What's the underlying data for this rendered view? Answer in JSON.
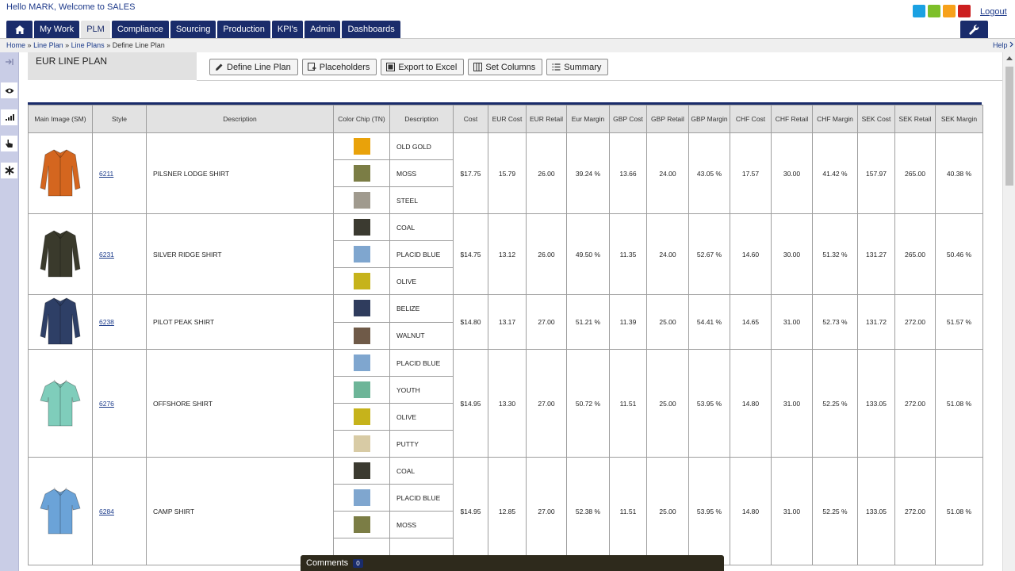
{
  "header": {
    "greeting": "Hello MARK, Welcome to SALES",
    "logout": "Logout",
    "theme_colors": [
      "#1ba1e2",
      "#7dbf2a",
      "#f7a11a",
      "#cc1f1f"
    ]
  },
  "nav": {
    "tabs": [
      {
        "label": "My Work"
      },
      {
        "label": "PLM",
        "active": true
      },
      {
        "label": "Compliance"
      },
      {
        "label": "Sourcing"
      },
      {
        "label": "Production"
      },
      {
        "label": "KPI's"
      },
      {
        "label": "Admin"
      },
      {
        "label": "Dashboards"
      }
    ]
  },
  "breadcrumb": {
    "home": "Home",
    "line_plan": "Line Plan",
    "line_plans": "Line Plans",
    "current": "Define Line Plan",
    "sep": "»",
    "help": "Help"
  },
  "page": {
    "title": "EUR LINE PLAN",
    "buttons": {
      "define": "Define Line Plan",
      "placeholders": "Placeholders",
      "export": "Export to Excel",
      "set_columns": "Set Columns",
      "summary": "Summary"
    }
  },
  "table": {
    "headers": {
      "main_image": "Main Image (SM)",
      "style": "Style",
      "description": "Description",
      "color_chip": "Color Chip (TN)",
      "color_desc": "Description",
      "cost": "Cost",
      "eur_cost": "EUR Cost",
      "eur_retail": "EUR Retail",
      "eur_margin": "Eur Margin",
      "gbp_cost": "GBP Cost",
      "gbp_retail": "GBP Retail",
      "gbp_margin": "GBP Margin",
      "chf_cost": "CHF Cost",
      "chf_retail": "CHF Retail",
      "chf_margin": "CHF Margin",
      "sek_cost": "SEK Cost",
      "sek_retail": "SEK Retail",
      "sek_margin": "SEK Margin"
    },
    "rows": [
      {
        "style": "6211",
        "description": "PILSNER LODGE SHIRT",
        "shirt_color": "#d4661f",
        "sleeve": "long",
        "colors": [
          {
            "name": "OLD GOLD",
            "hex": "#e9a20a"
          },
          {
            "name": "MOSS",
            "hex": "#7b7d45"
          },
          {
            "name": "STEEL",
            "hex": "#a09a8e"
          }
        ],
        "cost": "$17.75",
        "eur_cost": "15.79",
        "eur_retail": "26.00",
        "eur_margin": "39.24 %",
        "gbp_cost": "13.66",
        "gbp_retail": "24.00",
        "gbp_margin": "43.05 %",
        "chf_cost": "17.57",
        "chf_retail": "30.00",
        "chf_margin": "41.42 %",
        "sek_cost": "157.97",
        "sek_retail": "265.00",
        "sek_margin": "40.38 %"
      },
      {
        "style": "6231",
        "description": "SILVER RIDGE SHIRT",
        "shirt_color": "#3a3a2c",
        "sleeve": "long",
        "colors": [
          {
            "name": "COAL",
            "hex": "#3b3a30"
          },
          {
            "name": "PLACID BLUE",
            "hex": "#7fa6cf"
          },
          {
            "name": "OLIVE",
            "hex": "#c6b31b"
          }
        ],
        "cost": "$14.75",
        "eur_cost": "13.12",
        "eur_retail": "26.00",
        "eur_margin": "49.50 %",
        "gbp_cost": "11.35",
        "gbp_retail": "24.00",
        "gbp_margin": "52.67 %",
        "chf_cost": "14.60",
        "chf_retail": "30.00",
        "chf_margin": "51.32 %",
        "sek_cost": "131.27",
        "sek_retail": "265.00",
        "sek_margin": "50.46 %"
      },
      {
        "style": "6238",
        "description": "PILOT PEAK SHIRT",
        "shirt_color": "#2e3f66",
        "sleeve": "long",
        "colors": [
          {
            "name": "BELIZE",
            "hex": "#2f3c5d"
          },
          {
            "name": "WALNUT",
            "hex": "#6f5a48"
          }
        ],
        "cost": "$14.80",
        "eur_cost": "13.17",
        "eur_retail": "27.00",
        "eur_margin": "51.21 %",
        "gbp_cost": "11.39",
        "gbp_retail": "25.00",
        "gbp_margin": "54.41 %",
        "chf_cost": "14.65",
        "chf_retail": "31.00",
        "chf_margin": "52.73 %",
        "sek_cost": "131.72",
        "sek_retail": "272.00",
        "sek_margin": "51.57 %"
      },
      {
        "style": "6276",
        "description": "OFFSHORE SHIRT",
        "shirt_color": "#7fcdbb",
        "sleeve": "short",
        "colors": [
          {
            "name": "PLACID BLUE",
            "hex": "#7fa6cf"
          },
          {
            "name": "YOUTH",
            "hex": "#6db598"
          },
          {
            "name": "OLIVE",
            "hex": "#c6b31b"
          },
          {
            "name": "PUTTY",
            "hex": "#d8cba5"
          }
        ],
        "cost": "$14.95",
        "eur_cost": "13.30",
        "eur_retail": "27.00",
        "eur_margin": "50.72 %",
        "gbp_cost": "11.51",
        "gbp_retail": "25.00",
        "gbp_margin": "53.95 %",
        "chf_cost": "14.80",
        "chf_retail": "31.00",
        "chf_margin": "52.25 %",
        "sek_cost": "133.05",
        "sek_retail": "272.00",
        "sek_margin": "51.08 %"
      },
      {
        "style": "6284",
        "description": "CAMP SHIRT",
        "shirt_color": "#6ba3d8",
        "sleeve": "short",
        "colors": [
          {
            "name": "COAL",
            "hex": "#3b3a30"
          },
          {
            "name": "PLACID BLUE",
            "hex": "#7fa6cf"
          },
          {
            "name": "MOSS",
            "hex": "#7b7d45"
          },
          {
            "name": "",
            "hex": "#ffffff"
          }
        ],
        "cost": "$14.95",
        "eur_cost": "12.85",
        "eur_retail": "27.00",
        "eur_margin": "52.38 %",
        "gbp_cost": "11.51",
        "gbp_retail": "25.00",
        "gbp_margin": "53.95 %",
        "chf_cost": "14.80",
        "chf_retail": "31.00",
        "chf_margin": "52.25 %",
        "sek_cost": "133.05",
        "sek_retail": "272.00",
        "sek_margin": "51.08 %"
      }
    ]
  },
  "comments": {
    "label": "Comments",
    "count": "0"
  }
}
